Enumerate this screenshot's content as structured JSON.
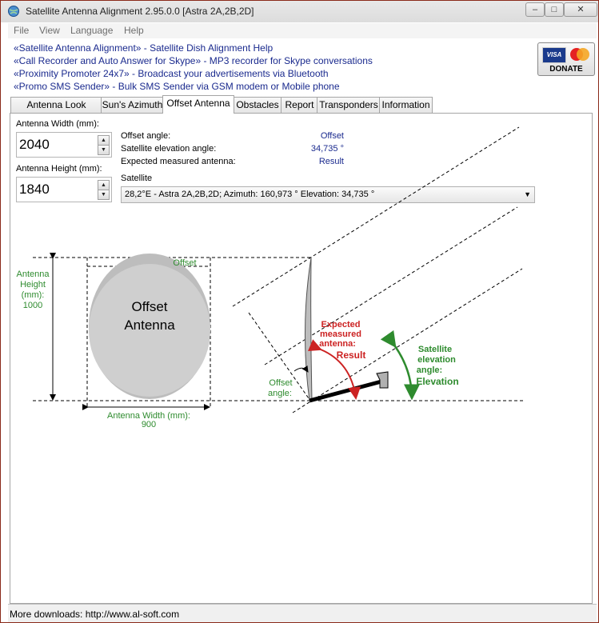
{
  "window": {
    "title": "Satellite Antenna Alignment 2.95.0.0 [Astra 2A,2B,2D]",
    "controls": {
      "minimize": "–",
      "maximize": "□",
      "close": "✕"
    }
  },
  "menu": [
    "File",
    "View",
    "Language",
    "Help"
  ],
  "promo_links": [
    "«Satellite Antenna Alignment» - Satellite Dish Alignment Help",
    "«Call Recorder and Auto Answer for Skype» - MP3 recorder for Skype conversations",
    "«Proximity Promoter 24x7» - Broadcast your advertisements via Bluetooth",
    "«Promo SMS Sender» - Bulk SMS Sender via GSM modem or Mobile phone"
  ],
  "donate": {
    "visa": "VISA",
    "mastercard": "MasterCard",
    "label": "DONATE"
  },
  "tabs": [
    {
      "label": "Antenna Look Angles",
      "active": false
    },
    {
      "label": "Sun's Azimuth",
      "active": false
    },
    {
      "label": "Offset Antenna",
      "active": true
    },
    {
      "label": "Obstacles",
      "active": false
    },
    {
      "label": "Report",
      "active": false
    },
    {
      "label": "Transponders",
      "active": false
    },
    {
      "label": "Information",
      "active": false
    }
  ],
  "inputs": {
    "width_label": "Antenna Width (mm):",
    "width_value": "2040",
    "height_label": "Antenna Height (mm):",
    "height_value": "1840"
  },
  "info": {
    "offset_angle_label": "Offset angle:",
    "offset_angle_value": "Offset",
    "elevation_label": "Satellite elevation angle:",
    "elevation_value": "34,735 °",
    "expected_label": "Expected measured antenna:",
    "expected_value": "Result",
    "satellite_label": "Satellite",
    "satellite_selected": "28,2°E - Astra 2A,2B,2D;  Azimuth: 160,973 °  Elevation: 34,735 °"
  },
  "diagram": {
    "antenna_title_1": "Offset",
    "antenna_title_2": "Antenna",
    "offset_top": "Offset",
    "height_label_1": "Antenna",
    "height_label_2": "Height",
    "height_label_3": "(mm):",
    "height_value": "1000",
    "width_label": "Antenna Width (mm):",
    "width_value": "900",
    "expected_1": "Expected",
    "expected_2": "measured",
    "expected_3": "antenna:",
    "expected_result": "Result",
    "sat_1": "Satellite",
    "sat_2": "elevation",
    "sat_3": "angle:",
    "sat_value": "Elevation",
    "offset_angle_1": "Offset",
    "offset_angle_2": "angle:"
  },
  "colors": {
    "green": "#2e8b2e",
    "red": "#cc2222",
    "link_blue": "#1a2a8e"
  },
  "status": "More downloads: http://www.al-soft.com"
}
